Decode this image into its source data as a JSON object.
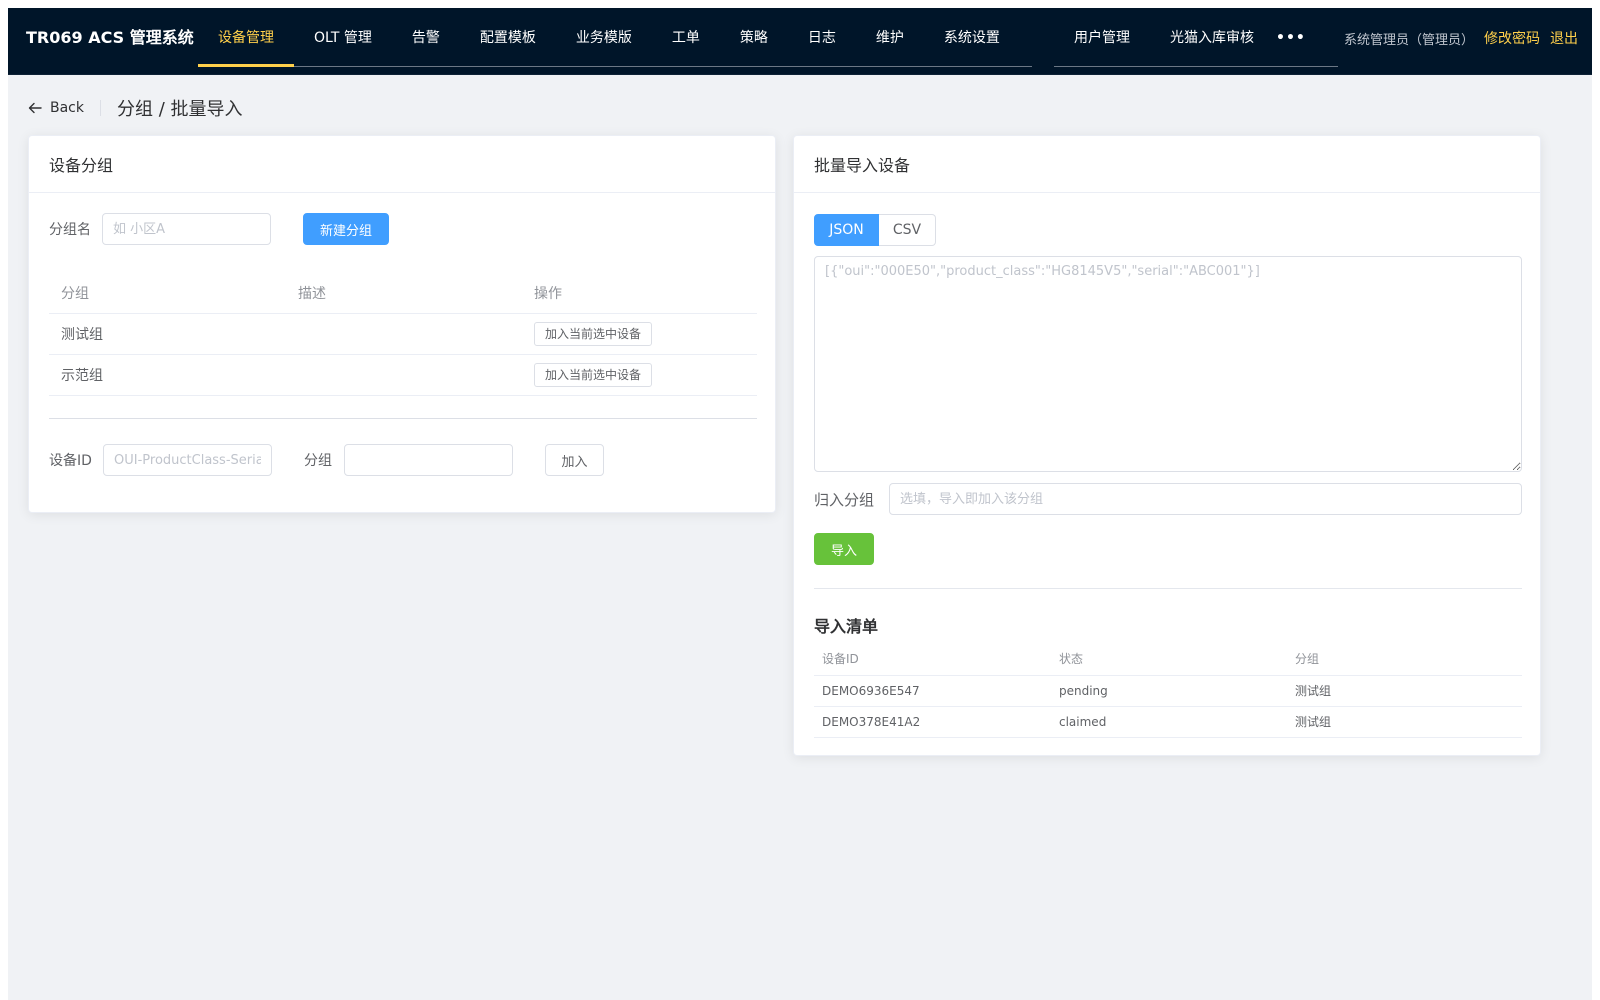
{
  "app": {
    "title": "TR069 ACS 管理系统"
  },
  "nav": {
    "items": [
      {
        "label": "设备管理",
        "active": true
      },
      {
        "label": "OLT 管理",
        "active": false
      },
      {
        "label": "告警",
        "active": false
      },
      {
        "label": "配置模板",
        "active": false
      },
      {
        "label": "业务模版",
        "active": false
      },
      {
        "label": "工单",
        "active": false
      },
      {
        "label": "策略",
        "active": false
      },
      {
        "label": "日志",
        "active": false
      },
      {
        "label": "维护",
        "active": false
      },
      {
        "label": "系统设置",
        "active": false
      }
    ],
    "extra_items": [
      {
        "label": "用户管理"
      },
      {
        "label": "光猫入库审核"
      }
    ],
    "more_label": "•••"
  },
  "user": {
    "name": "系统管理员（管理员）",
    "change_password": "修改密码",
    "logout": "退出"
  },
  "page": {
    "back_label": "Back",
    "title": "分组 / 批量导入"
  },
  "groups_card": {
    "title": "设备分组",
    "group_name_label": "分组名",
    "group_name_placeholder": "如 小区A",
    "create_button": "新建分组",
    "columns": [
      "分组",
      "描述",
      "操作"
    ],
    "rows": [
      {
        "group": "测试组",
        "description": "",
        "action": "加入当前选中设备"
      },
      {
        "group": "示范组",
        "description": "",
        "action": "加入当前选中设备"
      }
    ],
    "device_id_label": "设备ID",
    "device_id_placeholder": "OUI-ProductClass-Serial",
    "group_label": "分组",
    "group_value": "",
    "join_button": "加入"
  },
  "import_card": {
    "title": "批量导入设备",
    "format_tabs": [
      {
        "label": "JSON",
        "active": true
      },
      {
        "label": "CSV",
        "active": false
      }
    ],
    "textarea_placeholder": "[{\"oui\":\"000E50\",\"product_class\":\"HG8145V5\",\"serial\":\"ABC001\"}]",
    "assign_group_label": "归入分组",
    "assign_group_placeholder": "选填，导入即加入该分组",
    "import_button": "导入",
    "list_title": "导入清单",
    "list_columns": [
      "设备ID",
      "状态",
      "分组"
    ],
    "list_rows": [
      {
        "device_id": "DEMO6936E547",
        "status": "pending",
        "group": "测试组"
      },
      {
        "device_id": "DEMO378E41A2",
        "status": "claimed",
        "group": "测试组"
      }
    ]
  },
  "colors": {
    "nav_bg": "#001529",
    "nav_active": "#ffd04b",
    "primary": "#409eff",
    "success": "#67c23a",
    "page_bg": "#f0f2f5"
  }
}
